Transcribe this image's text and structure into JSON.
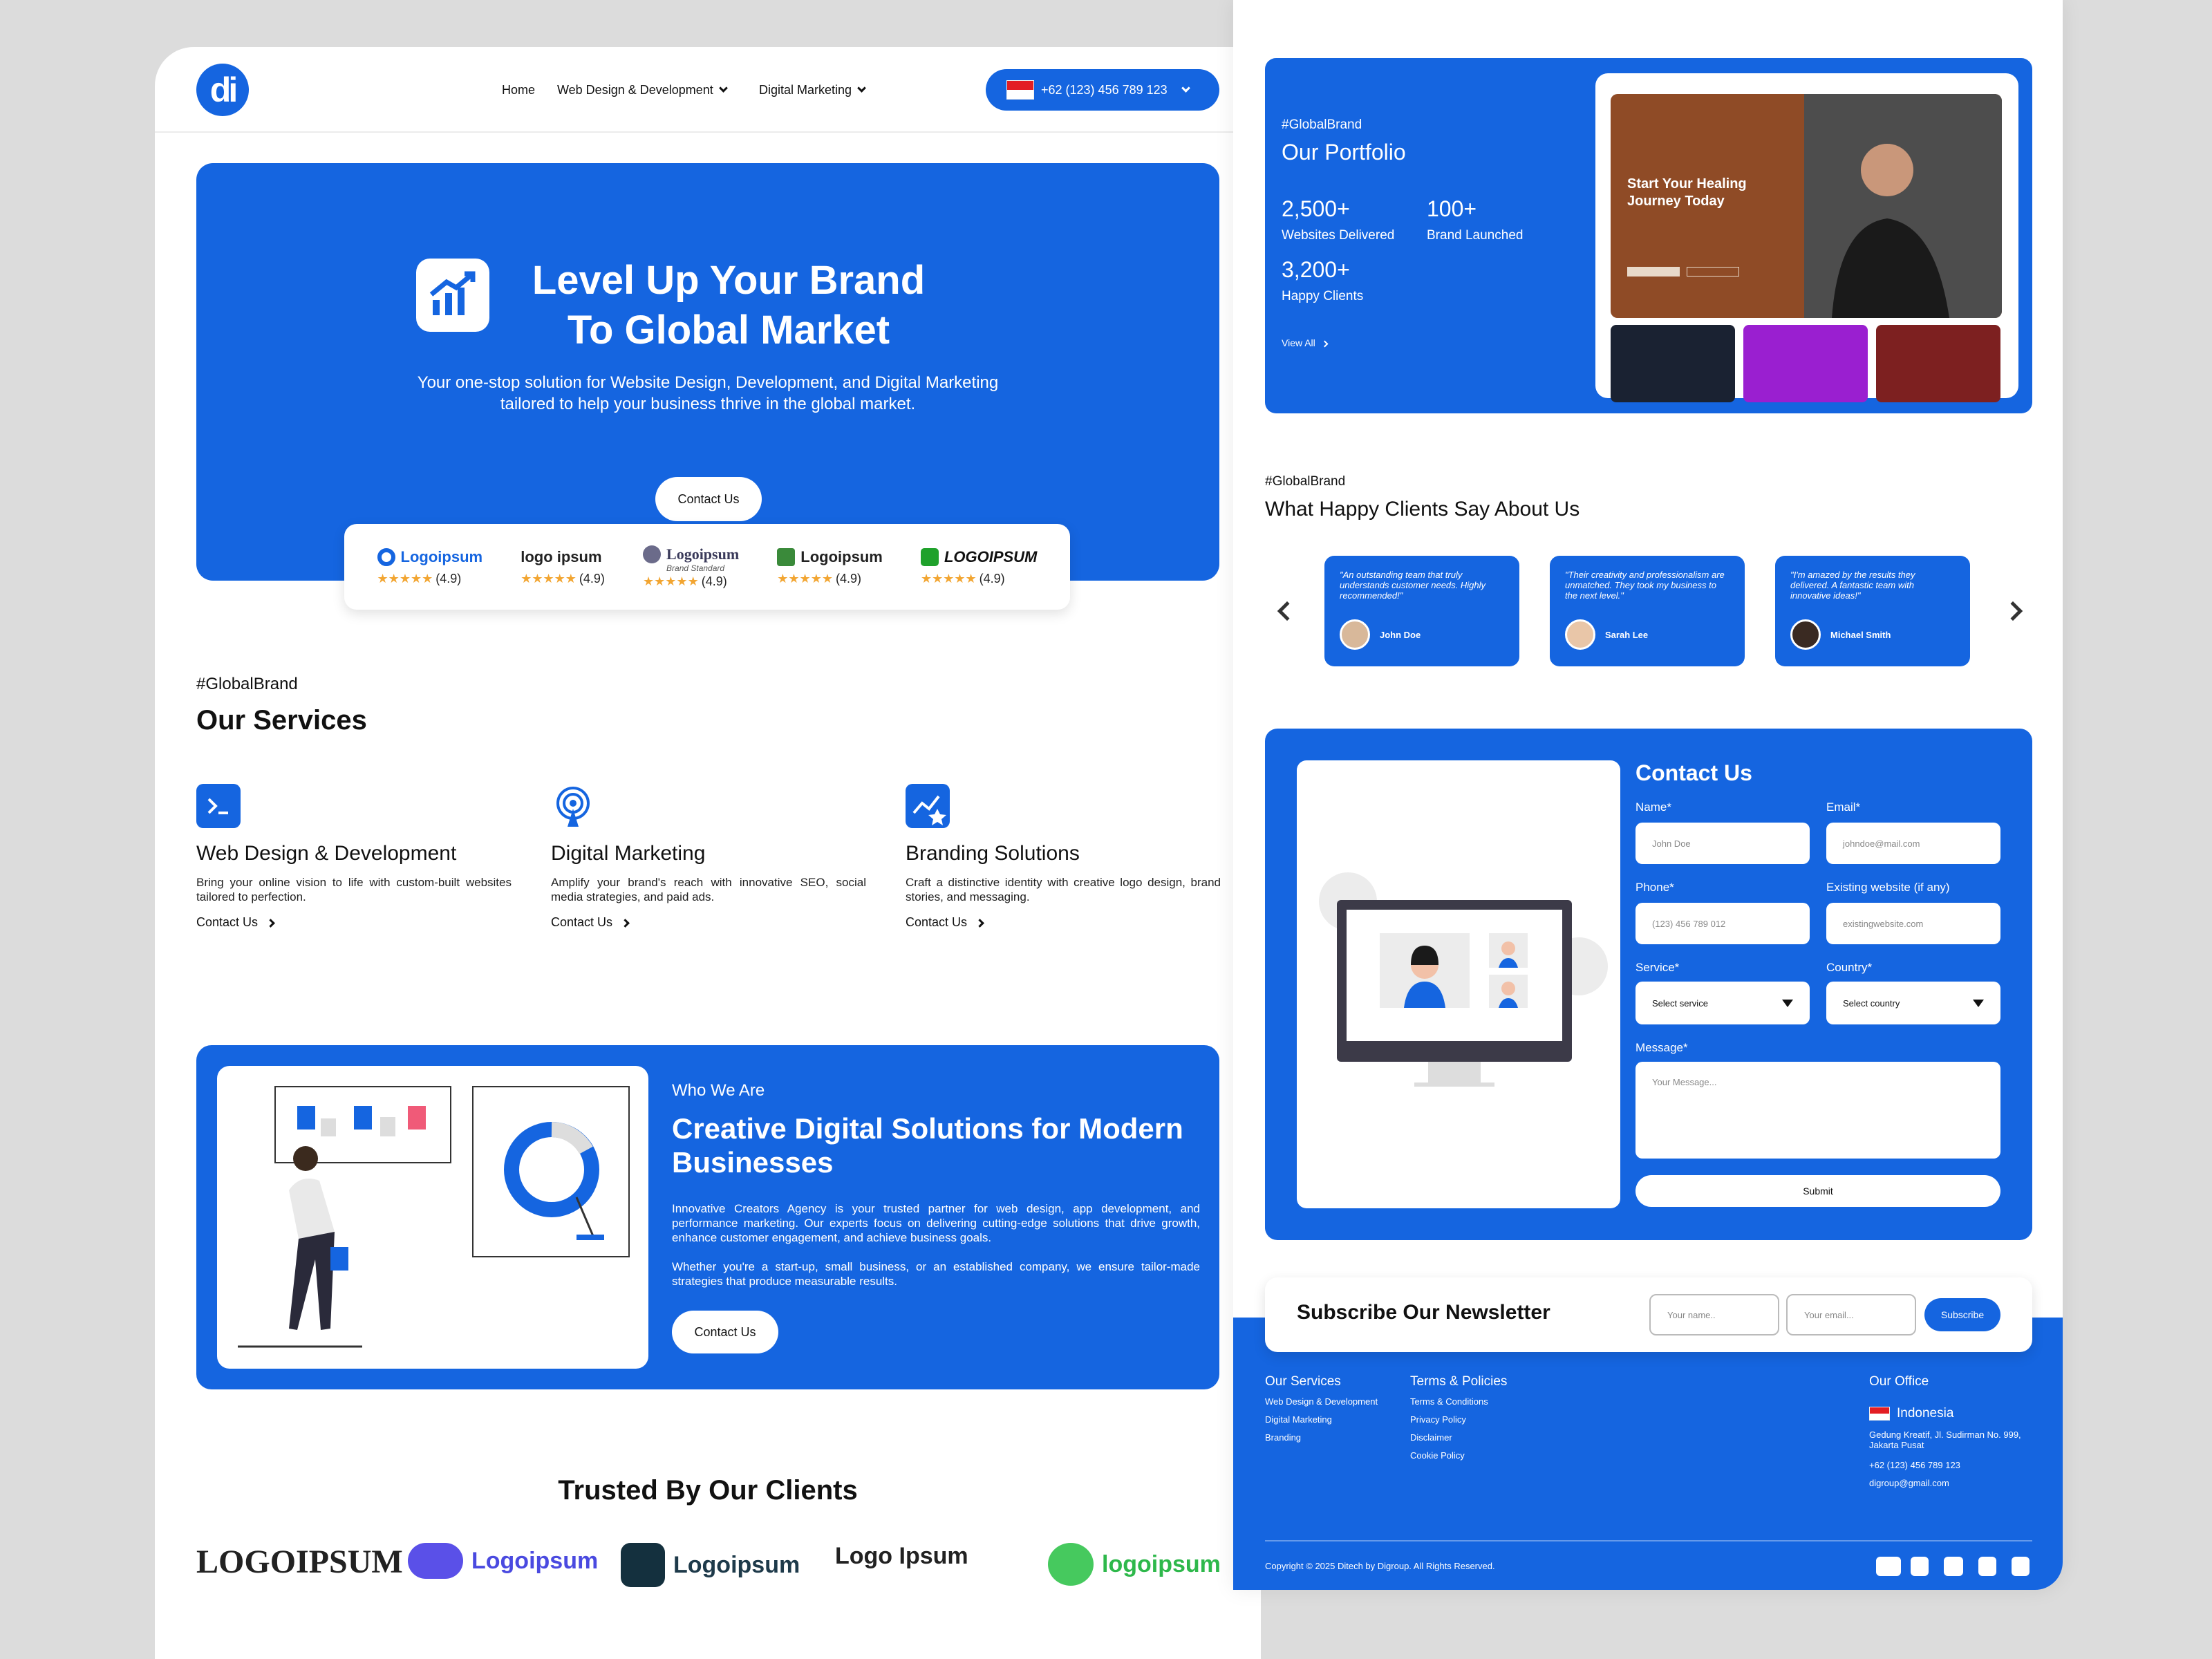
{
  "header": {
    "logo_text": "di",
    "nav": [
      "Home",
      "Web Design & Development",
      "Digital Marketing"
    ],
    "phone": "+62 (123) 456 789 123"
  },
  "hero": {
    "title_line1": "Level Up Your Brand",
    "title_line2": "To Global Market",
    "subtitle_line1": "Your one-stop solution for Website Design, Development, and Digital Marketing",
    "subtitle_line2": "tailored to help your business thrive in the global market.",
    "cta": "Contact Us",
    "ratings": [
      {
        "logo": "Logoipsum",
        "stars": "★★★★★",
        "score": "(4.9)",
        "color": "#1565e0"
      },
      {
        "logo": "logo ipsum",
        "stars": "★★★★★",
        "score": "(4.9)",
        "color": "#2e9e3e"
      },
      {
        "logo": "Logoipsum",
        "sub": "Brand Standard",
        "stars": "★★★★★",
        "score": "(4.9)",
        "color": "#6b6b8a"
      },
      {
        "logo": "Logoipsum",
        "stars": "★★★★★",
        "score": "(4.9)",
        "color": "#3a8a3a"
      },
      {
        "logo": "LOGOIPSUM",
        "stars": "★★★★★",
        "score": "(4.9)",
        "color": "#1fa12b"
      }
    ]
  },
  "services": {
    "tag": "#GlobalBrand",
    "title": "Our Services",
    "items": [
      {
        "icon": "terminal-icon",
        "title": "Web Design & Development",
        "desc": "Bring your online vision to life with custom-built websites tailored to perfection.",
        "link": "Contact Us"
      },
      {
        "icon": "broadcast-icon",
        "title": "Digital Marketing",
        "desc": "Amplify your brand's reach with innovative SEO, social media strategies, and paid ads.",
        "link": "Contact Us"
      },
      {
        "icon": "branding-icon",
        "title": "Branding Solutions",
        "desc": "Craft a distinctive identity with creative logo design, brand stories, and messaging.",
        "link": "Contact Us"
      }
    ]
  },
  "who": {
    "label": "Who We Are",
    "title": "Creative Digital Solutions for Modern Businesses",
    "p1": "Innovative Creators Agency is your trusted partner for web design, app development, and performance marketing. Our experts focus on delivering cutting-edge solutions that drive growth, enhance customer engagement, and achieve business goals.",
    "p2": "Whether you're a start-up, small business, or an established company, we ensure tailor-made strategies that produce measurable results.",
    "cta": "Contact Us"
  },
  "trusted": {
    "title": "Trusted By Our Clients",
    "logos": [
      "LOGOIPSUM",
      "Logoipsum",
      "Logoipsum",
      "Logo Ipsum",
      "logoipsum"
    ]
  },
  "portfolio": {
    "tag": "#GlobalBrand",
    "title": "Our Portfolio",
    "stats": [
      {
        "num": "2,500+",
        "label": "Websites Delivered"
      },
      {
        "num": "100+",
        "label": "Brand Launched"
      },
      {
        "num": "3,200+",
        "label": "Happy Clients"
      }
    ],
    "view_all": "View All",
    "preview_title": "Start Your Healing Journey Today"
  },
  "testimonials": {
    "tag": "#GlobalBrand",
    "title": "What Happy Clients Say About Us",
    "items": [
      {
        "quote": "\"An outstanding team that truly understands customer needs. Highly recommended!\"",
        "name": "John Doe"
      },
      {
        "quote": "\"Their creativity and professionalism are unmatched. They took my business to the next level.\"",
        "name": "Sarah Lee"
      },
      {
        "quote": "\"I'm amazed by the results they delivered. A fantastic team with innovative ideas!\"",
        "name": "Michael Smith"
      }
    ]
  },
  "contact": {
    "title": "Contact Us",
    "name_label": "Name*",
    "name_ph": "John Doe",
    "email_label": "Email*",
    "email_ph": "johndoe@mail.com",
    "phone_label": "Phone*",
    "phone_ph": "(123) 456 789 012",
    "site_label": "Existing website (if any)",
    "site_ph": "existingwebsite.com",
    "service_label": "Service*",
    "service_val": "Select service",
    "country_label": "Country*",
    "country_val": "Select country",
    "message_label": "Message*",
    "message_ph": "Your Message...",
    "submit": "Submit"
  },
  "newsletter": {
    "title": "Subscribe Our Newsletter",
    "name_ph": "Your name..",
    "email_ph": "Your email...",
    "button": "Subscribe"
  },
  "footer": {
    "services_title": "Our Services",
    "services": [
      "Web Design & Development",
      "Digital Marketing",
      "Branding"
    ],
    "policies_title": "Terms & Policies",
    "policies": [
      "Terms & Conditions",
      "Privacy Policy",
      "Disclaimer",
      "Cookie Policy"
    ],
    "office_title": "Our Office",
    "country": "Indonesia",
    "address": "Gedung Kreatif, Jl. Sudirman No. 999, Jakarta Pusat",
    "phone": "+62 (123) 456 789 123",
    "email": "digroup@gmail.com",
    "copyright": "Copyright © 2025 Ditech by Digroup. All Rights Reserved.",
    "socials": [
      "youtube-icon",
      "facebook-icon",
      "twitter-icon",
      "linkedin-icon",
      "instagram-icon"
    ]
  },
  "colors": {
    "accent": "#1565e0",
    "star": "#f2a531"
  }
}
